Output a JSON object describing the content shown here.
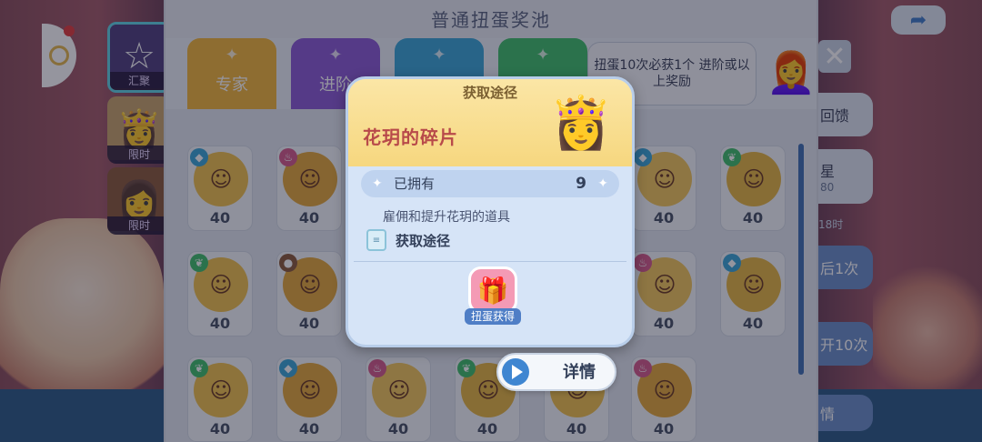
{
  "panel": {
    "title": "普通扭蛋奖池"
  },
  "tabs": [
    {
      "label": "专家",
      "color": "#f2b63a"
    },
    {
      "label": "进阶",
      "color": "#8a5ad6"
    },
    {
      "label": "",
      "color": "#39a6d8"
    },
    {
      "label": "",
      "color": "#3fbf6a"
    }
  ],
  "left_tabs": [
    {
      "label": "汇聚",
      "bg": "#4f3f7f"
    },
    {
      "label": "限时",
      "bg": "#c9a46a"
    },
    {
      "label": "限时",
      "bg": "#8a5a3a"
    }
  ],
  "speech_bubble": "扭蛋10次必获1个 进阶或以上奖励",
  "right_rail": {
    "btn_feedback": "回馈",
    "btn_star": "星",
    "star_count": "80",
    "timer": "18时",
    "btn_one": "后1次",
    "btn_ten": "开10次",
    "btn_bottom": "情"
  },
  "grid_cards": [
    {
      "value": "40",
      "tag": "diamond"
    },
    {
      "value": "40",
      "tag": "cupcake"
    },
    {
      "value": "40",
      "tag": "diamond"
    },
    {
      "value": "40",
      "tag": "leaf"
    },
    {
      "value": "40",
      "tag": "leaf"
    },
    {
      "value": "40",
      "tag": "coffee"
    },
    {
      "value": "40",
      "tag": "cupcake"
    },
    {
      "value": "40",
      "tag": "diamond"
    },
    {
      "value": "40",
      "tag": "leaf"
    },
    {
      "value": "40",
      "tag": "diamond"
    },
    {
      "value": "40",
      "tag": "cupcake"
    },
    {
      "value": "40",
      "tag": "leaf"
    },
    {
      "value": "40",
      "tag": ""
    },
    {
      "value": "40",
      "tag": "cupcake"
    }
  ],
  "modal": {
    "title": "获取途径",
    "item_name": "花玥的碎片",
    "owned_label": "已拥有",
    "owned_value": "9",
    "description": "雇佣和提升花玥的道具",
    "source_heading": "获取途径",
    "source_button": "扭蛋获得"
  },
  "detail_button": {
    "label": "详情"
  },
  "colors": {
    "accent_blue": "#3f86d1",
    "item_name_red": "#b84a4a",
    "modal_header_gold": "#f6d77f"
  }
}
